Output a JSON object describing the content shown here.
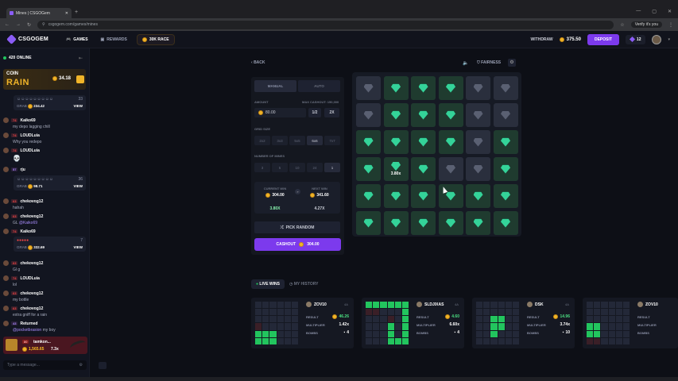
{
  "browser": {
    "tab_title": "Mines | CSGOGem",
    "url": "csgogem.com/games/mines",
    "profile": "Verify it's you"
  },
  "header": {
    "brand": "CSGOGEM",
    "nav_games": "GAMES",
    "nav_rewards": "REWARDS",
    "race": "30K RACE",
    "withdraw": "WITHDRAW",
    "balance": "375.50",
    "deposit": "DEPOSIT",
    "gems": "12"
  },
  "chat": {
    "online": "420 ONLINE",
    "rain_title": "COIN",
    "rain_big": "RAIN",
    "rain_amount": "34.18",
    "input_placeholder": "Type a message..."
  },
  "tip_cards": [
    {
      "count": "33",
      "label": "GRAB",
      "amount": "234.42",
      "action": "VIEW"
    },
    {
      "count": "36",
      "label": "GRAB",
      "amount": "98.71",
      "action": "VIEW"
    },
    {
      "count": "7",
      "label": "GRAB",
      "amount": "332.69",
      "action": "VIEW"
    }
  ],
  "messages": [
    {
      "level": "74",
      "name": "Kaiko69",
      "text": "my depo lagging chill"
    },
    {
      "level": "74",
      "name": "LOUDLuia",
      "text": "Why you redepo"
    },
    {
      "level": "74",
      "name": "LOUDLuia",
      "text": "💀"
    },
    {
      "level": "57",
      "name": "rju",
      "text": ""
    },
    {
      "level": "63",
      "name": "chekovog12",
      "text": "hahah"
    },
    {
      "level": "63",
      "name": "chekovog12",
      "text": "GL",
      "mention": "@Kaiko69"
    },
    {
      "level": "74",
      "name": "Kaiko69",
      "text": ""
    },
    {
      "level": "63",
      "name": "chekovog12",
      "text": "Gl g"
    },
    {
      "level": "74",
      "name": "LOUDLuia",
      "text": "lol"
    },
    {
      "level": "63",
      "name": "chekovog12",
      "text": "my bottle"
    },
    {
      "level": "63",
      "name": "chekovog12",
      "text": "extra gniff for a rain"
    },
    {
      "level": "43",
      "name": "Returned",
      "text": "my boy",
      "mention": "@pocketbrasion"
    }
  ],
  "win_feed": {
    "level": "80",
    "name": "tamkon...",
    "amount": "1,565.65",
    "multiplier": "7.3x"
  },
  "game": {
    "back": "BACK",
    "fairness": "FAIRNESS",
    "mode_manual": "MANUAL",
    "mode_auto": "AUTO",
    "amount_label": "AMOUNT",
    "max_label": "MAX CASHOUT: 150,000",
    "amount_value": "80.00",
    "half": "1/2",
    "double": "2X",
    "grid_label": "GRID SIZE",
    "grid_options": [
      "2x2",
      "3x3",
      "5x5",
      "6x6",
      "7x7"
    ],
    "grid_selected": 3,
    "mines_label": "NUMBER OF MINES",
    "mine_options": [
      "3",
      "5",
      "10",
      "24",
      "1"
    ],
    "mine_selected": 4,
    "current_win_label": "CURRENT WIN",
    "current_win": "304.00",
    "next_win_label": "NEXT WIN",
    "next_win": "341.60",
    "current_mult": "3.80X",
    "next_mult": "4.27X",
    "pick_random": "PICK RANDOM",
    "cashout": "CASHOUT",
    "cashout_amount": "304.00",
    "tile_mult": "3.80x",
    "board": [
      [
        "h",
        "g",
        "g",
        "g",
        "h",
        "h"
      ],
      [
        "h",
        "g",
        "g",
        "g",
        "h",
        "h"
      ],
      [
        "g",
        "g",
        "g",
        "g",
        "h",
        "g"
      ],
      [
        "g",
        "gm",
        "g",
        "h",
        "h",
        "g"
      ],
      [
        "g",
        "g",
        "g",
        "g",
        "g",
        "g"
      ],
      [
        "g",
        "g",
        "g",
        "g",
        "g",
        "g"
      ]
    ]
  },
  "live": {
    "tab_live": "LIVE WINS",
    "tab_history": "MY HISTORY",
    "result_label": "RESULT",
    "multiplier_label": "MULTIPLIER",
    "bombs_label": "BOMBS",
    "cards": [
      {
        "player": "ZOV10",
        "level": "4A",
        "result": "46.26",
        "multiplier": "1.42x",
        "bombs": "4"
      },
      {
        "player": "SLDJIXAS",
        "level": "4A",
        "result": "4.60",
        "multiplier": "6.60x",
        "bombs": "4"
      },
      {
        "player": "DSK",
        "level": "4A",
        "result": "14.96",
        "multiplier": "3.74x",
        "bombs": "10"
      },
      {
        "player": "ZOV10",
        "level": "4A",
        "result": "",
        "multiplier": "",
        "bombs": ""
      }
    ]
  },
  "colors": {
    "accent": "#7c3aed",
    "gem": "#34d399",
    "coin": "#f0b429"
  }
}
